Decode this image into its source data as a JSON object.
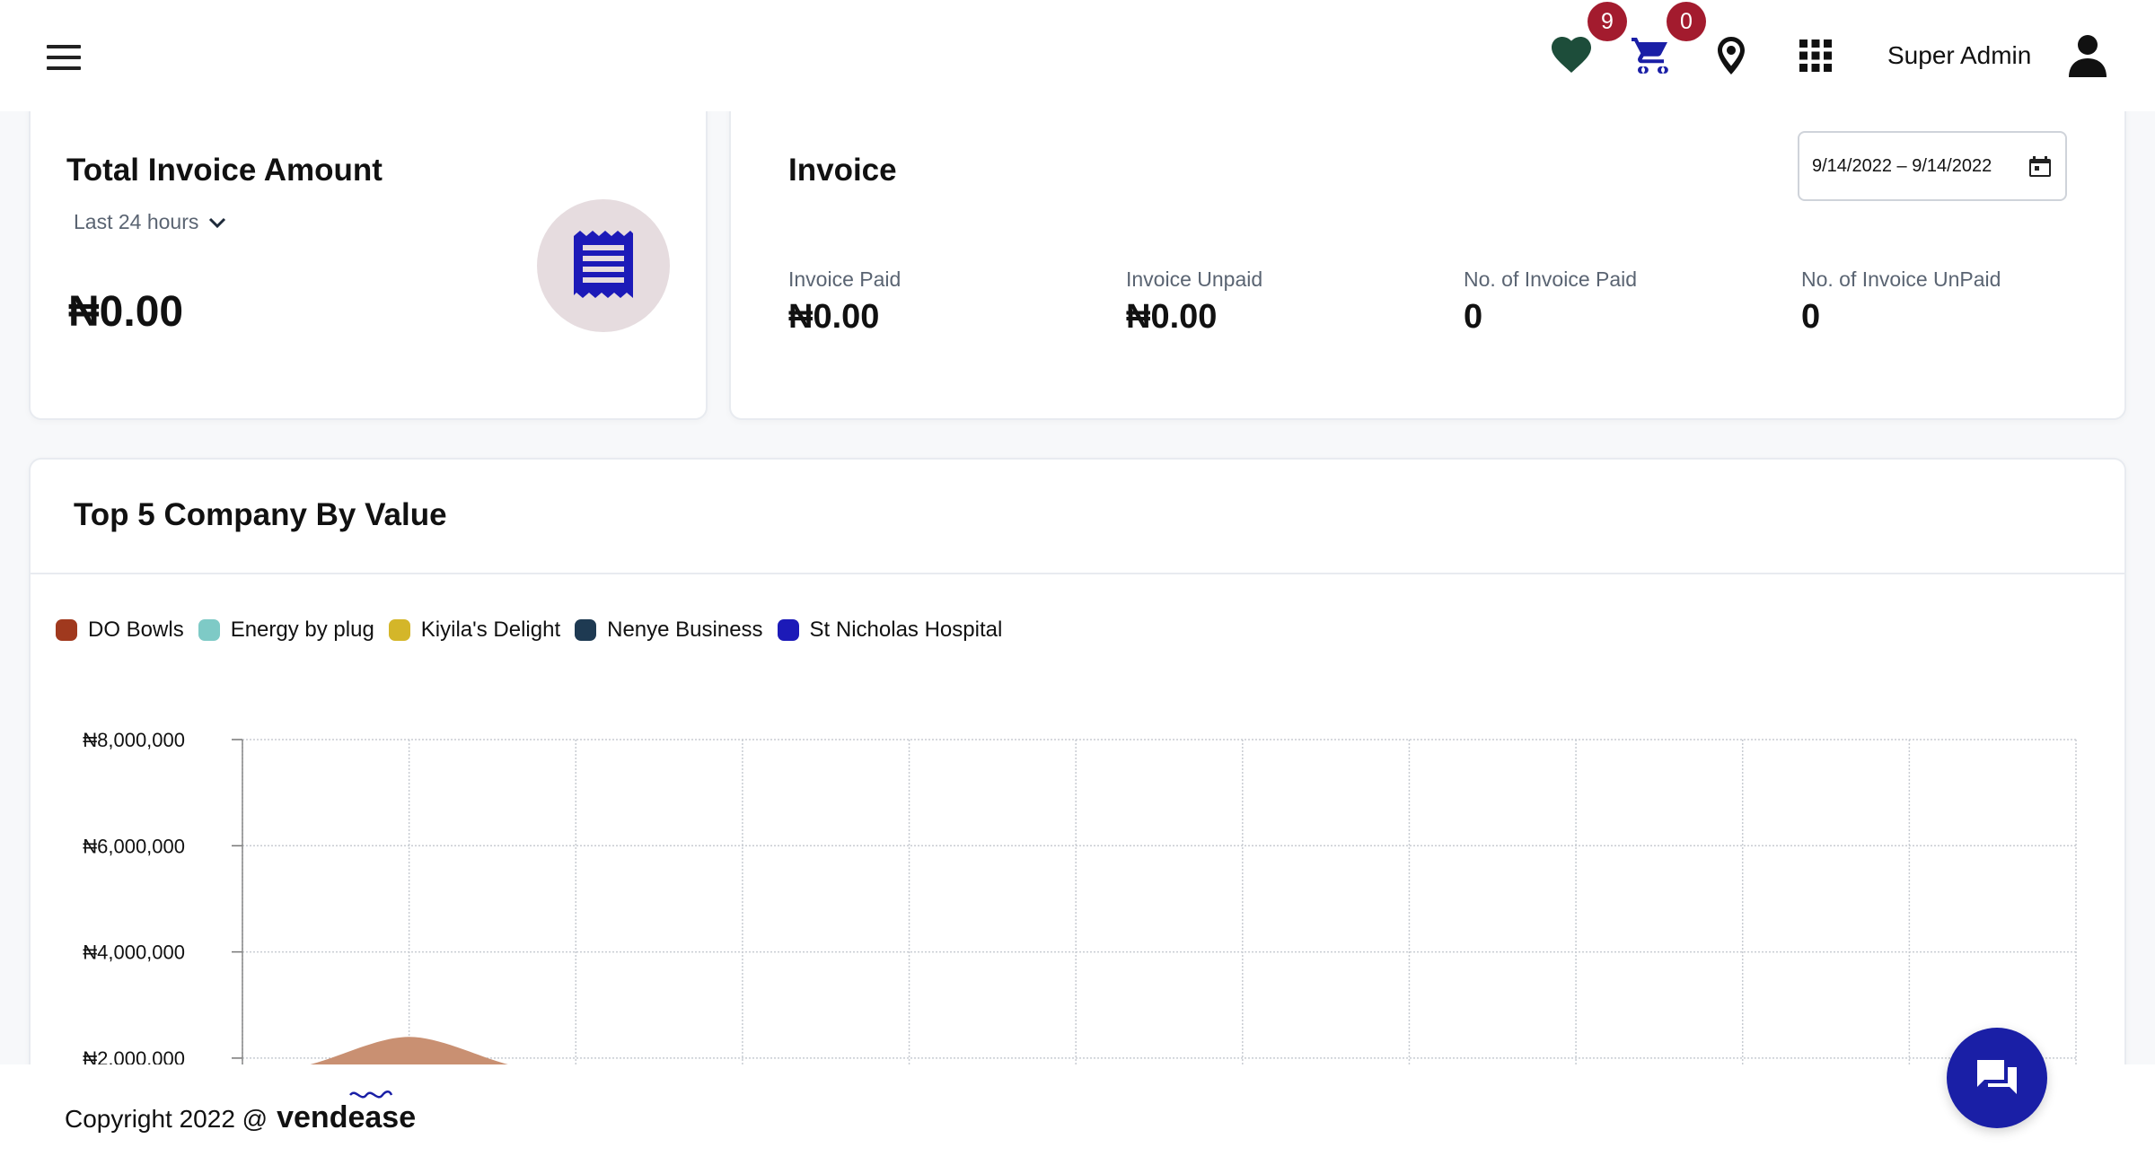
{
  "header": {
    "user_name": "Super Admin",
    "wishlist_count": "9",
    "cart_count": "0",
    "icons": {
      "menu": "hamburger-menu-icon",
      "wishlist": "heart-icon",
      "cart": "cart-icon",
      "location": "map-pin-icon",
      "apps": "grid-apps-icon",
      "user": "user-avatar-icon"
    }
  },
  "total_invoice_card": {
    "title": "Total Invoice Amount",
    "period": "Last 24 hours",
    "amount": "₦0.00",
    "icon": "receipt-icon"
  },
  "invoice_card": {
    "title": "Invoice",
    "date_range": "9/14/2022 – 9/14/2022",
    "stats": [
      {
        "label": "Invoice Paid",
        "value": "₦0.00"
      },
      {
        "label": "Invoice Unpaid",
        "value": "₦0.00"
      },
      {
        "label": "No. of Invoice Paid",
        "value": "0"
      },
      {
        "label": "No. of Invoice UnPaid",
        "value": "0"
      }
    ]
  },
  "chart_card": {
    "title": "Top 5 Company By Value"
  },
  "chart_data": {
    "type": "area",
    "title": "Top 5 Company By Value",
    "series": [
      {
        "name": "DO Bowls",
        "color": "#a0391e"
      },
      {
        "name": "Energy by plug",
        "color": "#7ecac6"
      },
      {
        "name": "Kiyila's Delight",
        "color": "#d4b629"
      },
      {
        "name": "Nenye Business",
        "color": "#1e3a52"
      },
      {
        "name": "St Nicholas Hospital",
        "color": "#1c1ab8"
      }
    ],
    "y_ticks": [
      "₦8,000,000",
      "₦6,000,000",
      "₦4,000,000",
      "₦2,000,000"
    ],
    "ylim": [
      0,
      8000000
    ],
    "visible_peak_value": 2400000,
    "grid": true,
    "legend_position": "top-left"
  },
  "footer": {
    "copyright": "Copyright 2022 @",
    "brand": "vendease"
  },
  "colors": {
    "accent": "#1a1fa6",
    "badge": "#a31b2e",
    "heart": "#1d4d3a",
    "cart": "#1a1fa6",
    "receipt_bg": "#e6dcdf",
    "receipt_icon": "#1c1ab8",
    "area_fill": "#c99072"
  },
  "chat_button": {
    "icon": "chat-bubble-icon"
  }
}
